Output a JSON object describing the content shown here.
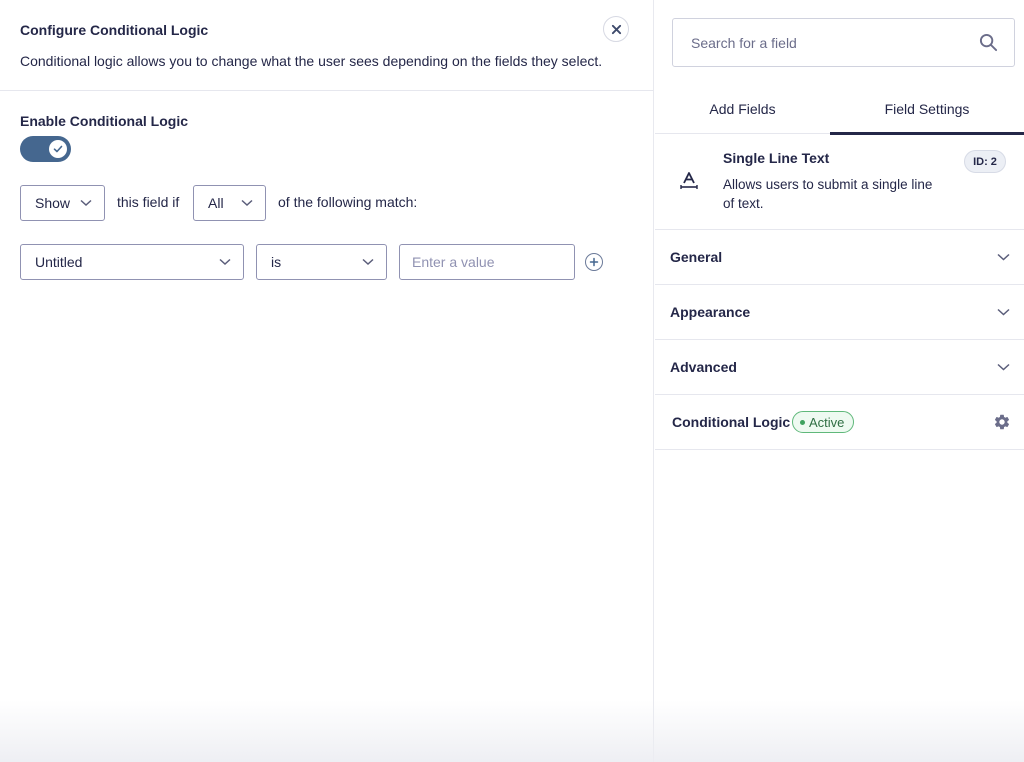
{
  "modal": {
    "title": "Configure Conditional Logic",
    "description": "Conditional logic allows you to change what the user sees depending on the fields they select.",
    "enable_label": "Enable Conditional Logic",
    "toggle_enabled": true,
    "action_select": "Show",
    "text_this_field_if": "this field if",
    "match_select": "All",
    "text_following_match": "of the following match:",
    "rule": {
      "field_select": "Untitled",
      "operator_select": "is",
      "value_placeholder": "Enter a value",
      "value": ""
    }
  },
  "sidebar": {
    "search_placeholder": "Search for a field",
    "tabs": [
      {
        "label": "Add Fields",
        "active": false
      },
      {
        "label": "Field Settings",
        "active": true
      }
    ],
    "field": {
      "title": "Single Line Text",
      "description": "Allows users to submit a single line of text.",
      "id_badge": "ID: 2"
    },
    "sections": [
      {
        "label": "General"
      },
      {
        "label": "Appearance"
      },
      {
        "label": "Advanced"
      }
    ],
    "conditional_logic": {
      "label": "Conditional Logic",
      "status": "Active"
    }
  },
  "colors": {
    "toggle_on": "#45678f",
    "text_primary": "#242748",
    "active_badge_border": "#5fb87a"
  }
}
